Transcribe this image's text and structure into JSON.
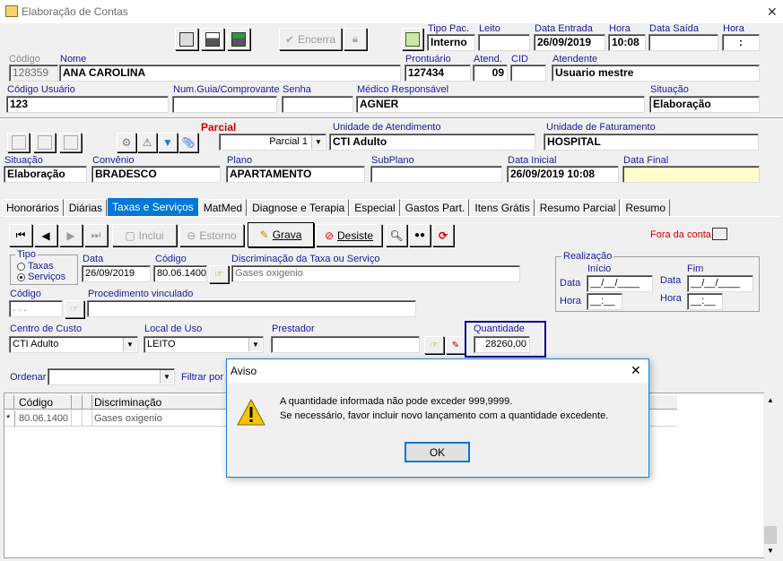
{
  "window": {
    "title": "Elaboração de Contas",
    "close": "✕"
  },
  "toolbar": {
    "encerra_label": "Encerra"
  },
  "patient": {
    "tipo_pac_label": "Tipo Pac.",
    "tipo_pac": "Interno",
    "leito_label": "Leito",
    "leito": "",
    "data_entrada_label": "Data Entrada",
    "data_entrada": "26/09/2019",
    "hora_label": "Hora",
    "hora": "10:08",
    "data_saida_label": "Data Saída",
    "data_saida": "",
    "hora2_label": "Hora",
    "hora2": ":",
    "codigo_label": "Código",
    "codigo": "128359",
    "nome_label": "Nome",
    "nome": "ANA  CAROLINA",
    "prontuario_label": "Prontuário",
    "prontuario": "127434",
    "atend_label": "Atend.",
    "atend": "09",
    "cid_label": "CID",
    "cid": "",
    "atendente_label": "Atendente",
    "atendente": "Usuario mestre",
    "codigo_usuario_label": "Código Usuário",
    "codigo_usuario": "123",
    "num_guia_label": "Num.Guia/Comprovante",
    "num_guia": "",
    "senha_label": "Senha",
    "senha": "",
    "medico_label": "Médico Responsável",
    "medico": "AGNER",
    "situacao_label": "Situação",
    "situacao": "Elaboração"
  },
  "parcial": {
    "title": "Parcial",
    "select": "Parcial 1",
    "unidade_atend_label": "Unidade de Atendimento",
    "unidade_atend": "CTI Adulto",
    "unidade_fat_label": "Unidade de Faturamento",
    "unidade_fat": "HOSPITAL",
    "situacao_label": "Situação",
    "situacao": "Elaboração",
    "convenio_label": "Convênio",
    "convenio": "BRADESCO",
    "plano_label": "Plano",
    "plano": "APARTAMENTO",
    "subplano_label": "SubPlano",
    "subplano": "",
    "data_inicial_label": "Data Inicial",
    "data_inicial": "26/09/2019 10:08",
    "data_final_label": "Data Final",
    "data_final": ""
  },
  "tabs": [
    "Honorários",
    "Diárias",
    "Taxas e Serviços",
    "MatMed",
    "Diagnose e Terapia",
    "Especial",
    "Gastos Part.",
    "Itens Grátis",
    "Resumo Parcial",
    "Resumo"
  ],
  "nav": {
    "inclui": "Inclui",
    "estorno": "Estorno",
    "grava": "Grava",
    "desiste": "Desiste",
    "fora_conta": "Fora da conta"
  },
  "form": {
    "tipo_label": "Tipo",
    "taxas": "Taxas",
    "servicos": "Serviços",
    "data_label": "Data",
    "data": "26/09/2019",
    "codigo_label": "Código",
    "codigo": "80.06.1400",
    "discriminacao_label": "Discriminação da Taxa ou Serviço",
    "discriminacao": "Gases oxigenio",
    "codigo2_label": "Código",
    "codigo2": ". . .",
    "proc_label": "Procedimento vinculado",
    "proc": "",
    "centro_label": "Centro de Custo",
    "centro": "CTI Adulto",
    "local_label": "Local de Uso",
    "local": "LEITO",
    "prestador_label": "Prestador",
    "prestador": "",
    "quantidade_label": "Quantidade",
    "quantidade": "28260,00",
    "realizacao_label": "Realização",
    "inicio_label": "Início",
    "fim_label": "Fim",
    "data_r_label": "Data",
    "hora_r_label": "Hora",
    "data_mask": "__/__/____",
    "hora_mask": "__:__",
    "ordenar_label": "Ordenar",
    "filtrar_label": "Filtrar por"
  },
  "grid": {
    "headers": [
      "Código",
      "Discriminação"
    ],
    "rows": [
      {
        "marker": "*",
        "codigo": "80.06.1400",
        "discriminacao": "Gases oxigenio"
      }
    ]
  },
  "dialog": {
    "title": "Aviso",
    "line1": "A quantidade informada não pode exceder 999,9999.",
    "line2": "Se necessário, favor incluir novo lançamento com a quantidade excedente.",
    "ok": "OK"
  }
}
